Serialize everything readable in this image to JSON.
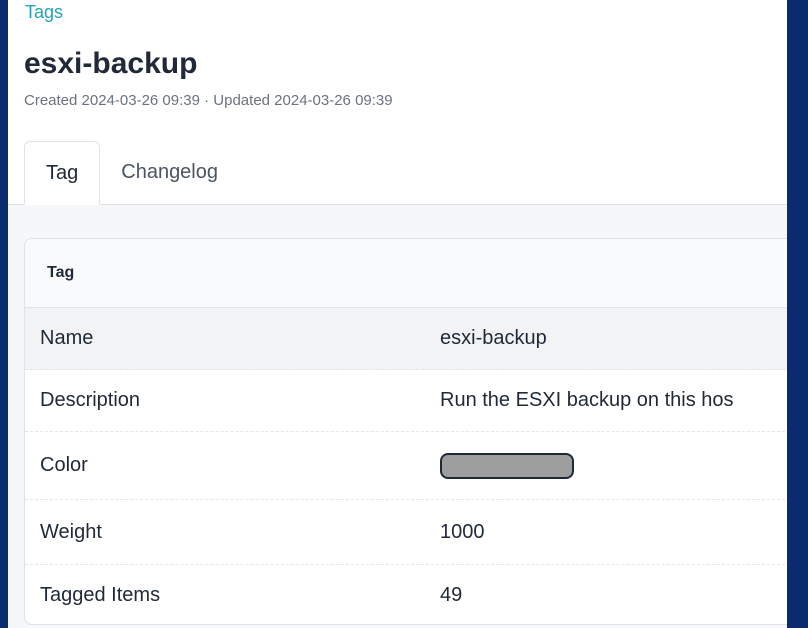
{
  "breadcrumb": "Tags",
  "title": "esxi-backup",
  "meta": "Created 2024-03-26 09:39 · Updated 2024-03-26 09:39",
  "tabs": [
    {
      "label": "Tag"
    },
    {
      "label": "Changelog"
    }
  ],
  "card": {
    "heading": "Tag",
    "rows": [
      {
        "label": "Name",
        "value": "esxi-backup"
      },
      {
        "label": "Description",
        "value": "Run the ESXI backup on this hos"
      },
      {
        "label": "Color",
        "color": "#9e9e9e"
      },
      {
        "label": "Weight",
        "value": "1000"
      },
      {
        "label": "Tagged Items",
        "value": "49"
      }
    ]
  },
  "colors": {
    "accent": "#20a4b6",
    "frame": "#0a2b6e"
  }
}
